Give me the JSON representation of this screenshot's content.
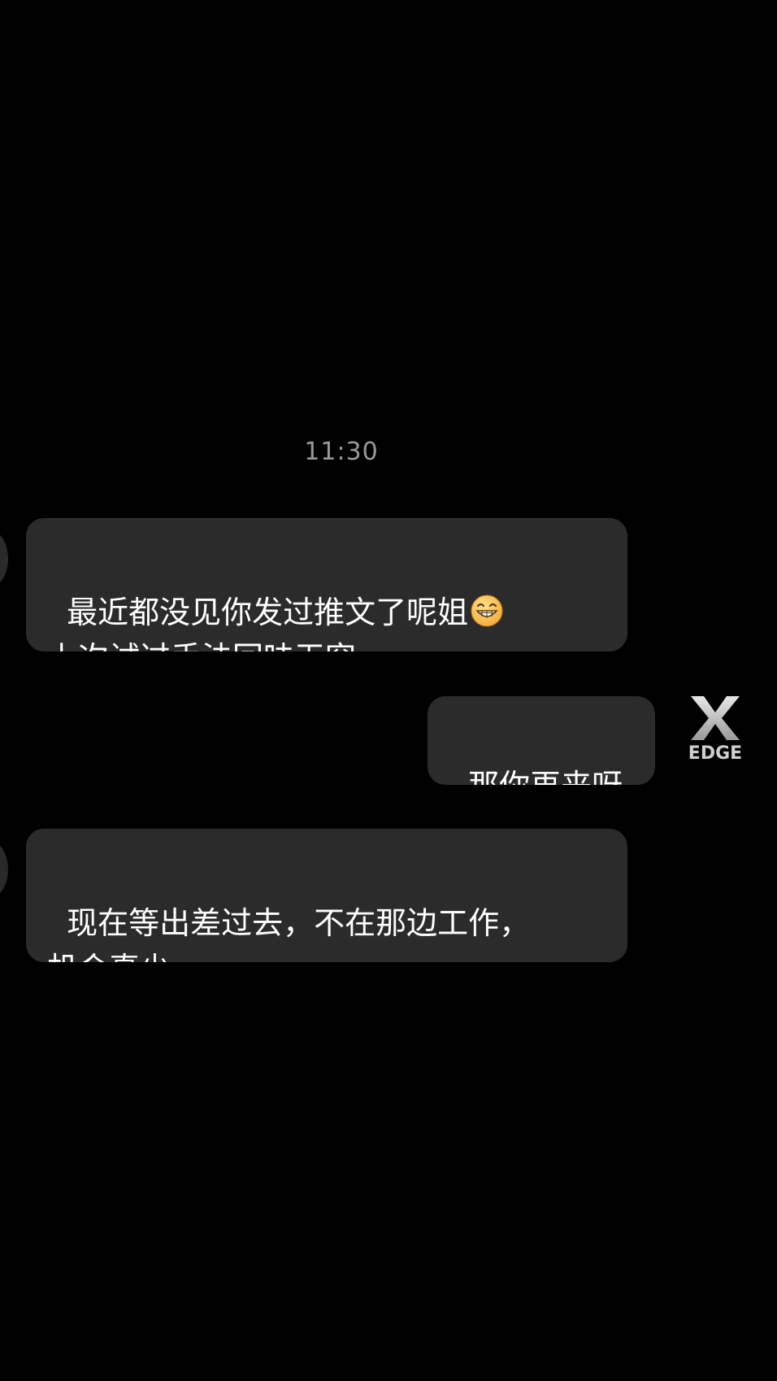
{
  "conversation": {
    "timestamp": "11:30",
    "messages": [
      {
        "direction": "incoming",
        "line1": "最近都没见你发过推文了呢姐",
        "emoji": "grinning-face-icon",
        "line2": "上次试过手法回味无穷"
      },
      {
        "direction": "outgoing",
        "text": "那你再来呀"
      },
      {
        "direction": "incoming",
        "line1": "现在等出差过去，不在那边工作，",
        "line2": "机会真少"
      }
    ]
  },
  "watermark": {
    "label": "EDGE"
  },
  "colors": {
    "background": "#000000",
    "bubble": "#2b2b2b",
    "timestamp": "#9a9a9a",
    "text": "#ffffff"
  }
}
